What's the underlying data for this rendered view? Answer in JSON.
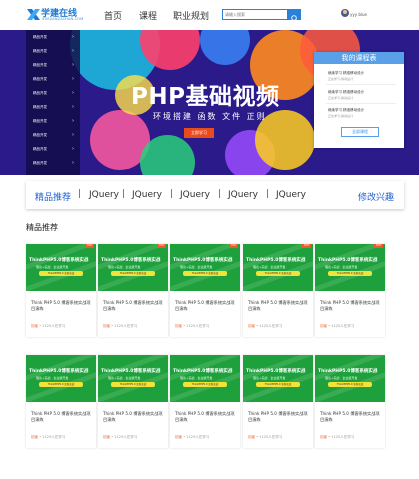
{
  "header": {
    "logo_name": "学建在线",
    "logo_sub": "XUEJIANZAIXIAN.COM",
    "nav": [
      "首页",
      "课程",
      "职业规划"
    ],
    "search_placeholder": "请输入搜索",
    "username": "yyy blue"
  },
  "colors": {
    "brand": "#1e78d2",
    "accent": "#f05a28",
    "banner_bg": "#2a1a8a",
    "thumb_green": "#1ea03c"
  },
  "banner": {
    "category_items": [
      "精品开发",
      "精品开发",
      "精品开发",
      "精品开发",
      "精品开发",
      "精品开发",
      "精品开发",
      "精品开发",
      "精品开发",
      "精品开发"
    ],
    "title": "PHP基础视频",
    "subtitle": "环境搭建  函数  文件  正则",
    "button": "立即学习"
  },
  "my_courses": {
    "title": "我的课程表",
    "items": [
      {
        "title": "继续学习 精准移动设计",
        "sub": "正在学习-移动设计"
      },
      {
        "title": "继续学习 精准移动设计",
        "sub": "正在学习-移动设计"
      },
      {
        "title": "继续学习 精准移动设计",
        "sub": "正在学习-移动设计"
      }
    ],
    "button": "全部课程"
  },
  "category_bar": {
    "items": [
      "精品推荐",
      "JQuery",
      "JQuery",
      "JQuery",
      "JQuery",
      "JQuery"
    ],
    "edit": "修改兴趣"
  },
  "section_title": "精品推荐",
  "thumb": {
    "title": "ThinkPHP5.0博客系统实战",
    "sub": "理论+实战 · 企业级开发",
    "bar": "ThinkPHP5.0 全新实战",
    "hot": "HOT"
  },
  "courses": [
    {
      "title": "Think PHP 5.0 博客系统实战项目演练",
      "tag": "初级",
      "meta": " • 1125人在学习"
    },
    {
      "title": "Think PHP 5.0 博客系统实战项目演练",
      "tag": "初级",
      "meta": " • 1125人在学习"
    },
    {
      "title": "Think PHP 5.0 博客系统实战项目演练",
      "tag": "初级",
      "meta": " • 1125人在学习"
    },
    {
      "title": "Think PHP 5.0 博客系统实战项目演练",
      "tag": "初级",
      "meta": " • 1125人在学习"
    },
    {
      "title": "Think PHP 5.0 博客系统实战项目演练",
      "tag": "初级",
      "meta": " • 1125人在学习"
    },
    {
      "title": "Think PHP 5.0 博客系统实战项目演练",
      "tag": "初级",
      "meta": " • 1125人在学习"
    },
    {
      "title": "Think PHP 5.0 博客系统实战项目演练",
      "tag": "初级",
      "meta": " • 1125人在学习"
    },
    {
      "title": "Think PHP 5.0 博客系统实战项目演练",
      "tag": "初级",
      "meta": " • 1125人在学习"
    },
    {
      "title": "Think PHP 5.0 博客系统实战项目演练",
      "tag": "初级",
      "meta": " • 1125人在学习"
    },
    {
      "title": "Think PHP 5.0 博客系统实战项目演练",
      "tag": "初级",
      "meta": " • 1125人在学习"
    }
  ]
}
